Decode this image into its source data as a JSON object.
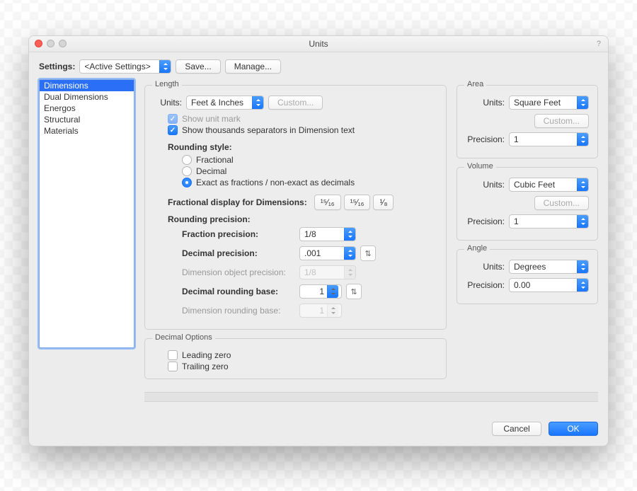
{
  "window": {
    "title": "Units"
  },
  "toolbar": {
    "settings_label": "Settings:",
    "settings_value": "<Active Settings>",
    "save_label": "Save...",
    "manage_label": "Manage..."
  },
  "sidebar": {
    "items": [
      "Dimensions",
      "Dual Dimensions",
      "Energos",
      "Structural",
      "Materials"
    ],
    "selected_index": 0
  },
  "length": {
    "caption": "Length",
    "units_label": "Units:",
    "units_value": "Feet & Inches",
    "custom_label": "Custom...",
    "show_unit_mark_label": "Show unit mark",
    "thousands_label": "Show thousands separators in Dimension text",
    "rounding_style_label": "Rounding style:",
    "rounding_options": [
      "Fractional",
      "Decimal",
      "Exact as fractions / non-exact as decimals"
    ],
    "rounding_selected": 2,
    "frac_display_label": "Fractional display for Dimensions:",
    "frac_display_icons": [
      "¹⁵⁄₁₆",
      "¹⁵⁄₁₆",
      "¹⁄₈"
    ],
    "rounding_precision_label": "Rounding precision:",
    "fraction_precision_label": "Fraction precision:",
    "fraction_precision_value": "1/8",
    "decimal_precision_label": "Decimal precision:",
    "decimal_precision_value": ".001",
    "dim_obj_precision_label": "Dimension object precision:",
    "dim_obj_precision_value": "1/8",
    "decimal_rounding_base_label": "Decimal rounding base:",
    "decimal_rounding_base_value": "1",
    "dim_rounding_base_label": "Dimension rounding base:",
    "dim_rounding_base_value": "1"
  },
  "decimal_options": {
    "caption": "Decimal Options",
    "leading_zero_label": "Leading zero",
    "trailing_zero_label": "Trailing zero"
  },
  "area": {
    "caption": "Area",
    "units_label": "Units:",
    "units_value": "Square Feet",
    "custom_label": "Custom...",
    "precision_label": "Precision:",
    "precision_value": "1"
  },
  "volume": {
    "caption": "Volume",
    "units_label": "Units:",
    "units_value": "Cubic Feet",
    "custom_label": "Custom...",
    "precision_label": "Precision:",
    "precision_value": "1"
  },
  "angle": {
    "caption": "Angle",
    "units_label": "Units:",
    "units_value": "Degrees",
    "precision_label": "Precision:",
    "precision_value": "0.00"
  },
  "buttons": {
    "cancel": "Cancel",
    "ok": "OK"
  }
}
